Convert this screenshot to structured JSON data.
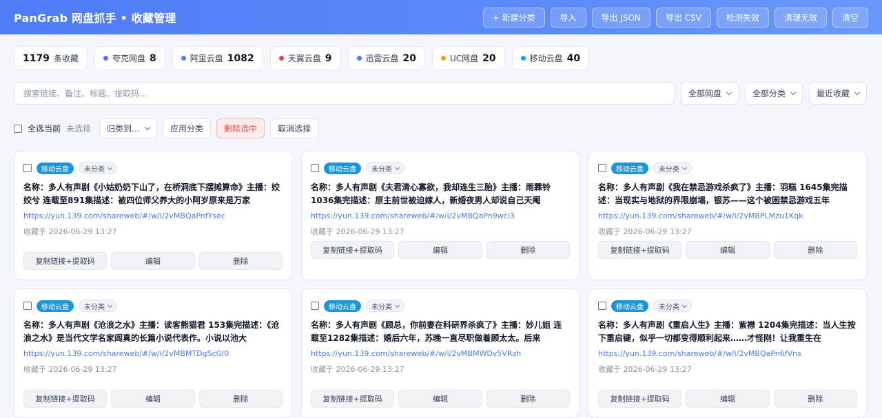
{
  "app": {
    "title": "PanGrab 网盘抓手 • 收藏管理"
  },
  "header_buttons": [
    "+ 新建分类",
    "导入",
    "导出 JSON",
    "导出 CSV",
    "检测失效",
    "清理无效",
    "清空"
  ],
  "stats": {
    "total": {
      "num": "1179",
      "label": "条收藏"
    },
    "providers": [
      {
        "label": "夸克网盘",
        "num": "8",
        "color": "#5b6ef5"
      },
      {
        "label": "阿里云盘",
        "num": "1082",
        "color": "#4f7cf7"
      },
      {
        "label": "天翼云盘",
        "num": "9",
        "color": "#ef4444"
      },
      {
        "label": "迅雷云盘",
        "num": "20",
        "color": "#3b82f6"
      },
      {
        "label": "UC网盘",
        "num": "20",
        "color": "#f59e0b"
      },
      {
        "label": "移动云盘",
        "num": "40",
        "color": "#0ea5e9"
      }
    ]
  },
  "search": {
    "placeholder": "搜索链接、备注、标题、提取码…",
    "value": ""
  },
  "filters": {
    "provider": "全部网盘",
    "category": "全部分类",
    "sort": "最近收藏"
  },
  "bulk": {
    "select_all": "全选当前",
    "selected_status": "未选择",
    "move_to": "归类到…",
    "apply": "应用分类",
    "delete": "删除选中",
    "cancel": "取消选择"
  },
  "card_actions": {
    "copy": "复制链接+提取码",
    "edit": "编辑",
    "delete": "删除"
  },
  "cards": [
    {
      "provider": "移动云盘",
      "category": "未分类",
      "title": "名称：多人有声剧《小姑奶奶下山了，在桥洞底下摆摊算命》主播：姣姣兮 连载至891集描述：被四位师父养大的小阿岁原来是万家",
      "link": "https://yun.139.com/shareweb/#/w/i/2vMBQaPnfYsec",
      "date": "收藏于 2026-06-29 13:27"
    },
    {
      "provider": "移动云盘",
      "category": "未分类",
      "title": "名称：多人有声剧《夫君清心寡欲，我却连生三胎》主播：雨霖铃 1036集完描述：原主前世被迫嫁人，新婚夜男人却说自己天阉",
      "link": "https://yun.139.com/shareweb/#/w/i/2vMBQaPn9wci3",
      "date": "收藏于 2026-06-29 13:27"
    },
    {
      "provider": "移动云盘",
      "category": "未分类",
      "title": "名称：多人有声剧《我在禁忌游戏杀疯了》主播：羽糕 1645集完描述：当现实与地狱的界限崩塌，银苏——这个被困禁忌游戏五年",
      "link": "https://yun.139.com/shareweb/#/w/i/2vMBPLMzu1Kqk",
      "date": "收藏于 2026-06-29 13:27"
    },
    {
      "provider": "移动云盘",
      "category": "未分类",
      "title": "名称：多人有声剧《沧浪之水》主播：读客熊猫君 153集完描述：《沧浪之水》是当代文学名家阎真的长篇小说代表作。小说以池大",
      "link": "https://yun.139.com/shareweb/#/w/i/2vMBMTDgScGl0",
      "date": "收藏于 2026-06-29 13:27"
    },
    {
      "provider": "移动云盘",
      "category": "未分类",
      "title": "名称：多人有声剧《顾总，你前妻在科研界杀疯了》主播：妙儿姐 连载至1282集描述：婚后六年，苏晚一直尽职做着顾太太。后来",
      "link": "https://yun.139.com/shareweb/#/w/i/2vMBMWDv5VRzh",
      "date": "收藏于 2026-06-29 13:27"
    },
    {
      "provider": "移动云盘",
      "category": "未分类",
      "title": "名称：多人有声剧《重启人生》主播：紫襟 1204集完描述：当人生按下重启键，似乎一切都变得顺利起来……才怪刚！让我重生在",
      "link": "https://yun.139.com/shareweb/#/w/i/2vMBQaPn6fVns",
      "date": "收藏于 2026-06-29 13:27"
    }
  ]
}
